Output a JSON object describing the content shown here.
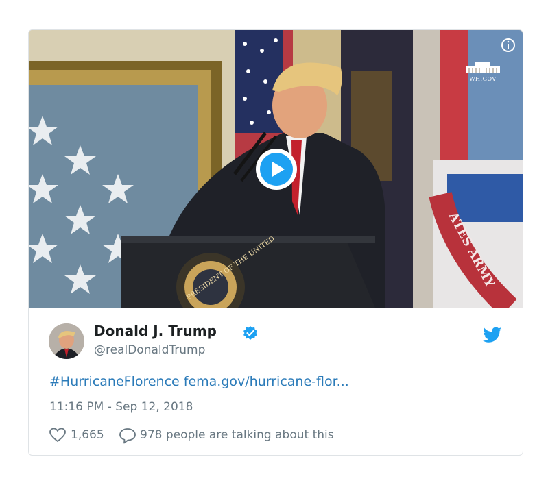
{
  "media": {
    "watermark_text": "WH.GOV",
    "seal_text": "PRESIDENT OF THE UNITED",
    "flag_text": "ATES ARMY",
    "play_icon": "play-circle-icon",
    "info_icon": "info-icon"
  },
  "tweet": {
    "author_name": "Donald J. Trump",
    "handle": "@realDonaldTrump",
    "hashtag": "#HurricaneFlorence",
    "link": "fema.gov/hurricane-flor...",
    "timestamp": "11:16 PM - Sep 12, 2018",
    "likes": "1,665",
    "talking": "978 people are talking about this",
    "verified_icon": "verified-badge-icon",
    "brand_icon": "twitter-bird-icon"
  },
  "colors": {
    "accent": "#1da1f2",
    "link": "#2b7bb9",
    "text": "#1c2022",
    "muted": "#697882"
  }
}
